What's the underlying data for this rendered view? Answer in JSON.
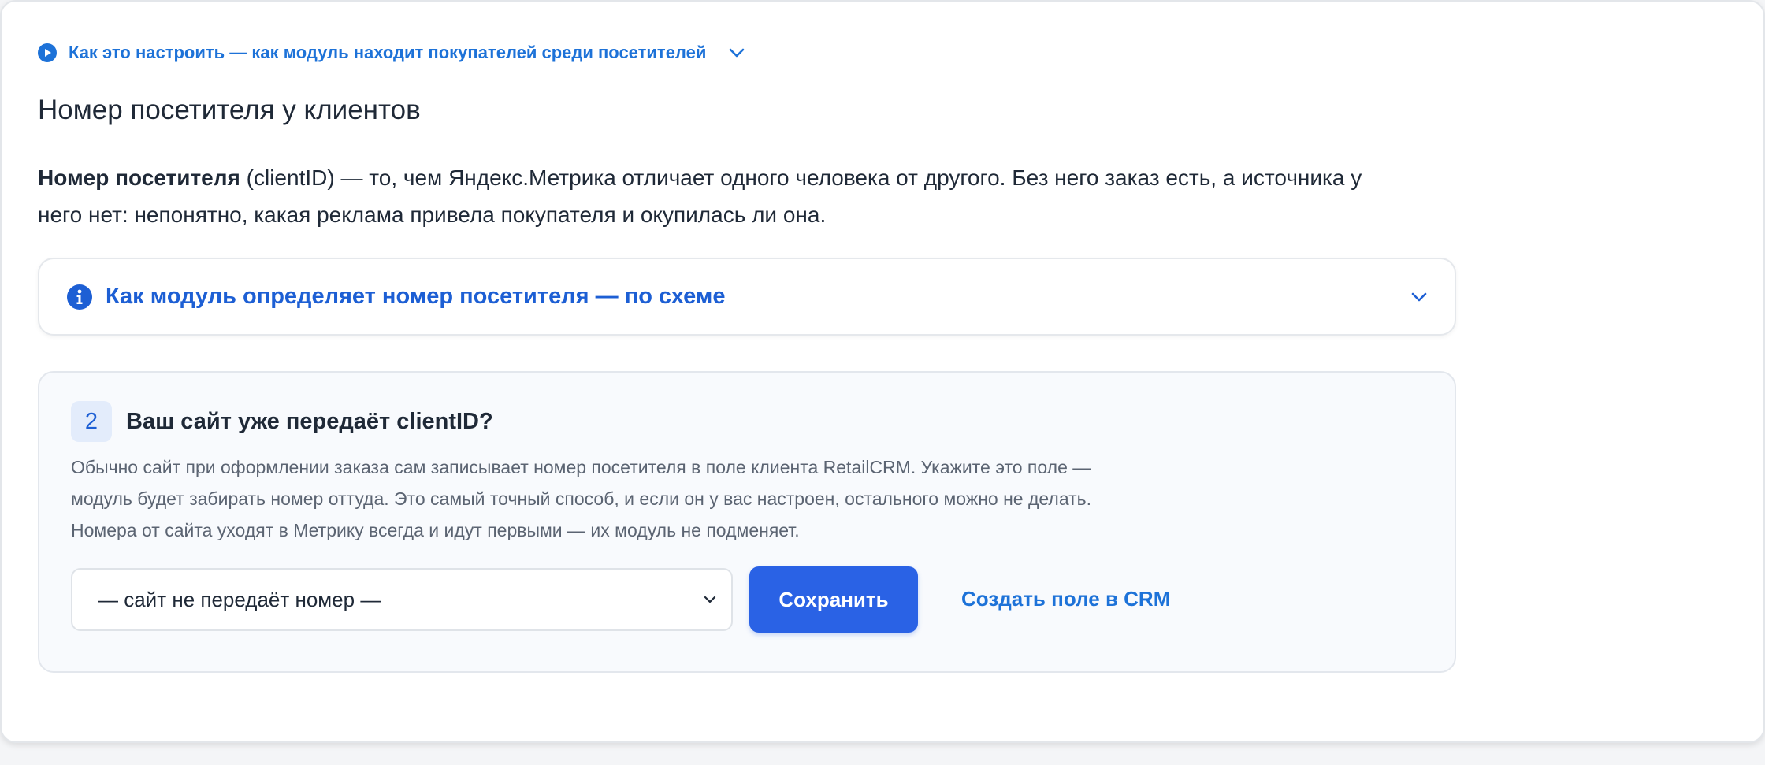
{
  "top_link": {
    "label": "Как это настроить — как модуль находит покупателей среди посетителей",
    "play_icon": "play-circle-icon",
    "chevron_icon": "chevron-down-icon"
  },
  "section": {
    "title": "Номер посетителя у клиентов",
    "intro_bold": "Номер посетителя",
    "intro_rest": " (clientID) — то, чем Яндекс.Метрика отличает одного человека от другого. Без него заказ есть, а источника у него нет: непонятно, какая реклама привела покупателя и окупилась ли она."
  },
  "accordion": {
    "label": "Как модуль определяет номер посетителя — по схеме",
    "info_icon": "info-circle-icon",
    "chevron_icon": "chevron-down-icon"
  },
  "step": {
    "number": "2",
    "title": "Ваш сайт уже передаёт clientID?",
    "desc_line1": "Обычно сайт при оформлении заказа сам записывает номер посетителя в поле клиента RetailCRM. Укажите это поле —",
    "desc_line2": "модуль будет забирать номер оттуда. Это самый точный способ, и если он у вас настроен, остального можно не делать.",
    "desc_line3": "Номера от сайта уходят в Метрику всегда и идут первыми — их модуль не подменяет.",
    "select_value": "— сайт не передаёт номер —",
    "save_label": "Сохранить",
    "crm_link_label": "Создать поле в CRM"
  },
  "colors": {
    "accent": "#2a62e5",
    "link": "#1d72d8",
    "heading_link": "#1d5fd4",
    "panel_bg": "#f8fafd"
  }
}
